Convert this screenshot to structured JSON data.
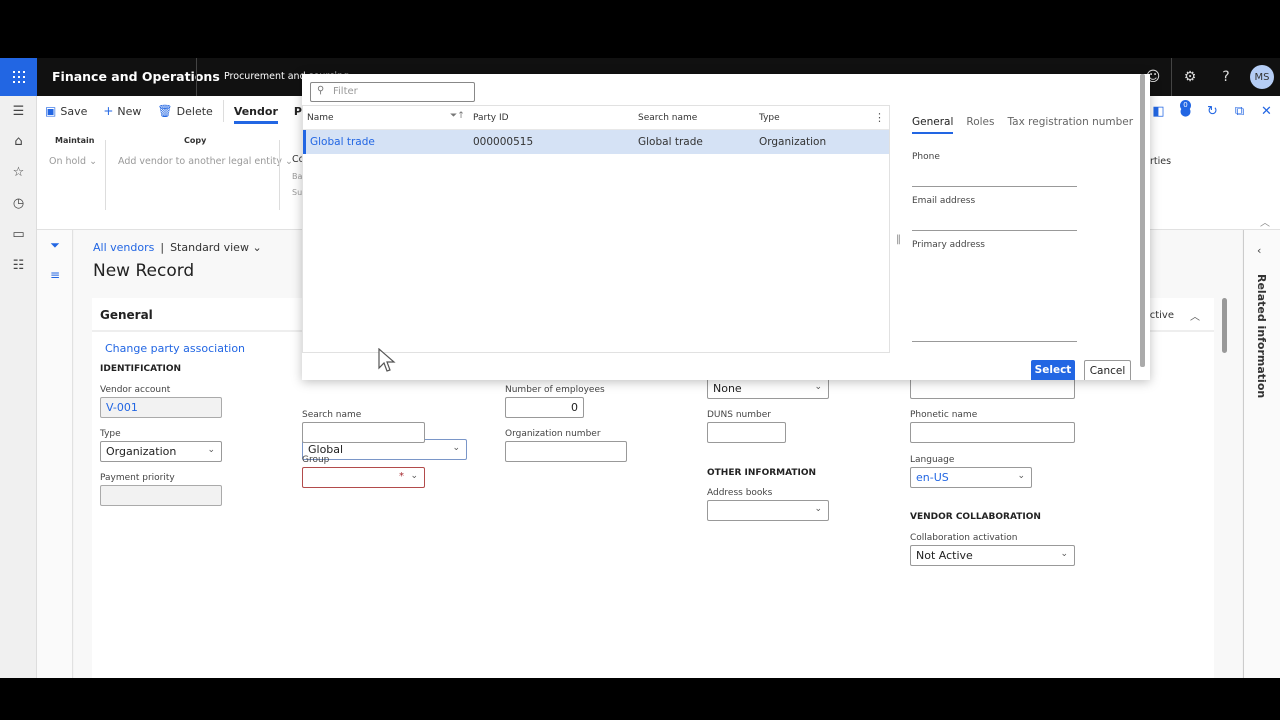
{
  "app": {
    "title": "Finance and Operations",
    "breadcrumb": "Procurement and sourcing",
    "avatar_initials": "MS",
    "notification_count": "0"
  },
  "actionpane": {
    "save": "Save",
    "new": "New",
    "delete": "Delete",
    "tabs": [
      "Vendor",
      "Procurement"
    ],
    "active_tab": "Vendor",
    "groups": [
      {
        "title": "Maintain",
        "items": [
          "On hold"
        ]
      },
      {
        "title": "Copy",
        "items": [
          "Add vendor to another legal entity"
        ]
      },
      {
        "title": "Co",
        "items": [
          "Ba",
          "Su"
        ]
      }
    ],
    "partial_right": "rties"
  },
  "page": {
    "crumb_link": "All vendors",
    "crumb_sep": "|",
    "view": "Standard view",
    "title": "New Record"
  },
  "card": {
    "title": "General",
    "status": "Active",
    "change_party_link": "Change party association",
    "identification_label": "IDENTIFICATION",
    "vendor_account_label": "Vendor account",
    "vendor_account_value": "V-001",
    "type_label": "Type",
    "type_value": "Organization",
    "payment_priority_label": "Payment priority",
    "payment_priority_value": "",
    "name_value": "Global",
    "search_name_label": "Search name",
    "search_name_value": "",
    "group_label": "Group",
    "group_value": "",
    "group_required": "*",
    "employees_label": "Number of employees",
    "employees_value": "0",
    "org_number_label": "Organization number",
    "org_number_value": "",
    "col4_top_value": "None",
    "duns_label": "DUNS number",
    "duns_value": "",
    "other_info_label": "OTHER INFORMATION",
    "address_books_label": "Address books",
    "address_books_value": "",
    "col5_top_value": "",
    "phonetic_label": "Phonetic name",
    "phonetic_value": "",
    "language_label": "Language",
    "language_value": "en-US",
    "vendor_collab_label": "VENDOR COLLABORATION",
    "collab_activation_label": "Collaboration activation",
    "collab_activation_value": "Not Active"
  },
  "related": {
    "label": "Related information"
  },
  "dialog": {
    "filter_placeholder": "Filter",
    "columns": [
      "Name",
      "Party ID",
      "Search name",
      "Type"
    ],
    "rows": [
      {
        "name": "Global trade",
        "party_id": "000000515",
        "search_name": "Global trade",
        "type": "Organization"
      }
    ],
    "tabs": [
      "General",
      "Roles",
      "Tax registration number"
    ],
    "active_tab": "General",
    "phone_label": "Phone",
    "email_label": "Email address",
    "primary_address_label": "Primary address",
    "select": "Select",
    "cancel": "Cancel"
  }
}
